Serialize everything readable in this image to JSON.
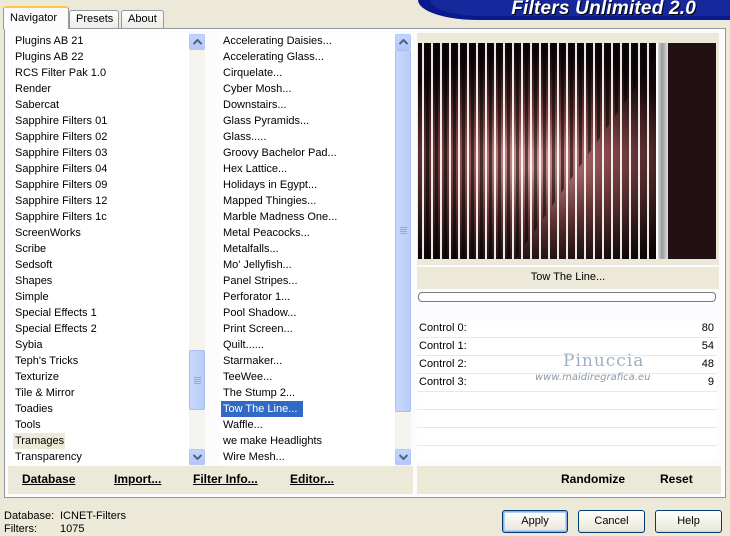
{
  "tabs": [
    "Navigator",
    "Presets",
    "About"
  ],
  "banner_title": "Filters Unlimited 2.0",
  "categories": [
    "Plugins AB 21",
    "Plugins AB 22",
    "RCS Filter Pak 1.0",
    "Render",
    "Sabercat",
    "Sapphire Filters 01",
    "Sapphire Filters 02",
    "Sapphire Filters 03",
    "Sapphire Filters 04",
    "Sapphire Filters 09",
    "Sapphire Filters 12",
    "Sapphire Filters 1c",
    "ScreenWorks",
    "Scribe",
    "Sedsoft",
    "Shapes",
    "Simple",
    "Special Effects 1",
    "Special Effects 2",
    "Sybia",
    "Teph's Tricks",
    "Texturize",
    "Tile & Mirror",
    "Toadies",
    "Tools",
    "Tramages",
    "Transparency"
  ],
  "selected_category": "Tramages",
  "filters": [
    "Accelerating Daisies...",
    "Accelerating Glass...",
    "Cirquelate...",
    "Cyber Mosh...",
    "Downstairs...",
    "Glass Pyramids...",
    "Glass.....",
    "Groovy Bachelor Pad...",
    "Hex Lattice...",
    "Holidays in Egypt...",
    "Mapped Thingies...",
    "Marble Madness One...",
    "Metal Peacocks...",
    "Metalfalls...",
    "Mo' Jellyfish...",
    "Panel Stripes...",
    "Perforator 1...",
    "Pool Shadow...",
    "Print Screen...",
    "Quilt......",
    "Starmaker...",
    "TeeWee...",
    "The Stump 2...",
    "Tow The Line...",
    "Waffle...",
    "we make Headlights",
    "Wire Mesh..."
  ],
  "selected_filter": "Tow The Line...",
  "left_commands": [
    "Database",
    "Import...",
    "Filter Info...",
    "Editor..."
  ],
  "preview_filter_name": "Tow The Line...",
  "controls": [
    {
      "label": "Control 0:",
      "value": "80"
    },
    {
      "label": "Control 1:",
      "value": "54"
    },
    {
      "label": "Control 2:",
      "value": "48"
    },
    {
      "label": "Control 3:",
      "value": "9"
    }
  ],
  "watermark": {
    "name": "Pinuccia",
    "url": "www.maidiregrafica.eu"
  },
  "right_commands": [
    "Randomize",
    "Reset"
  ],
  "status": {
    "database_label": "Database:",
    "database_value": "ICNET-Filters",
    "filters_label": "Filters:",
    "filters_value": "1075"
  },
  "buttons": {
    "apply": "Apply",
    "cancel": "Cancel",
    "help": "Help"
  },
  "colors": {
    "selection": "#316ac5",
    "banner": "#17279c",
    "window": "#ece9d8"
  }
}
